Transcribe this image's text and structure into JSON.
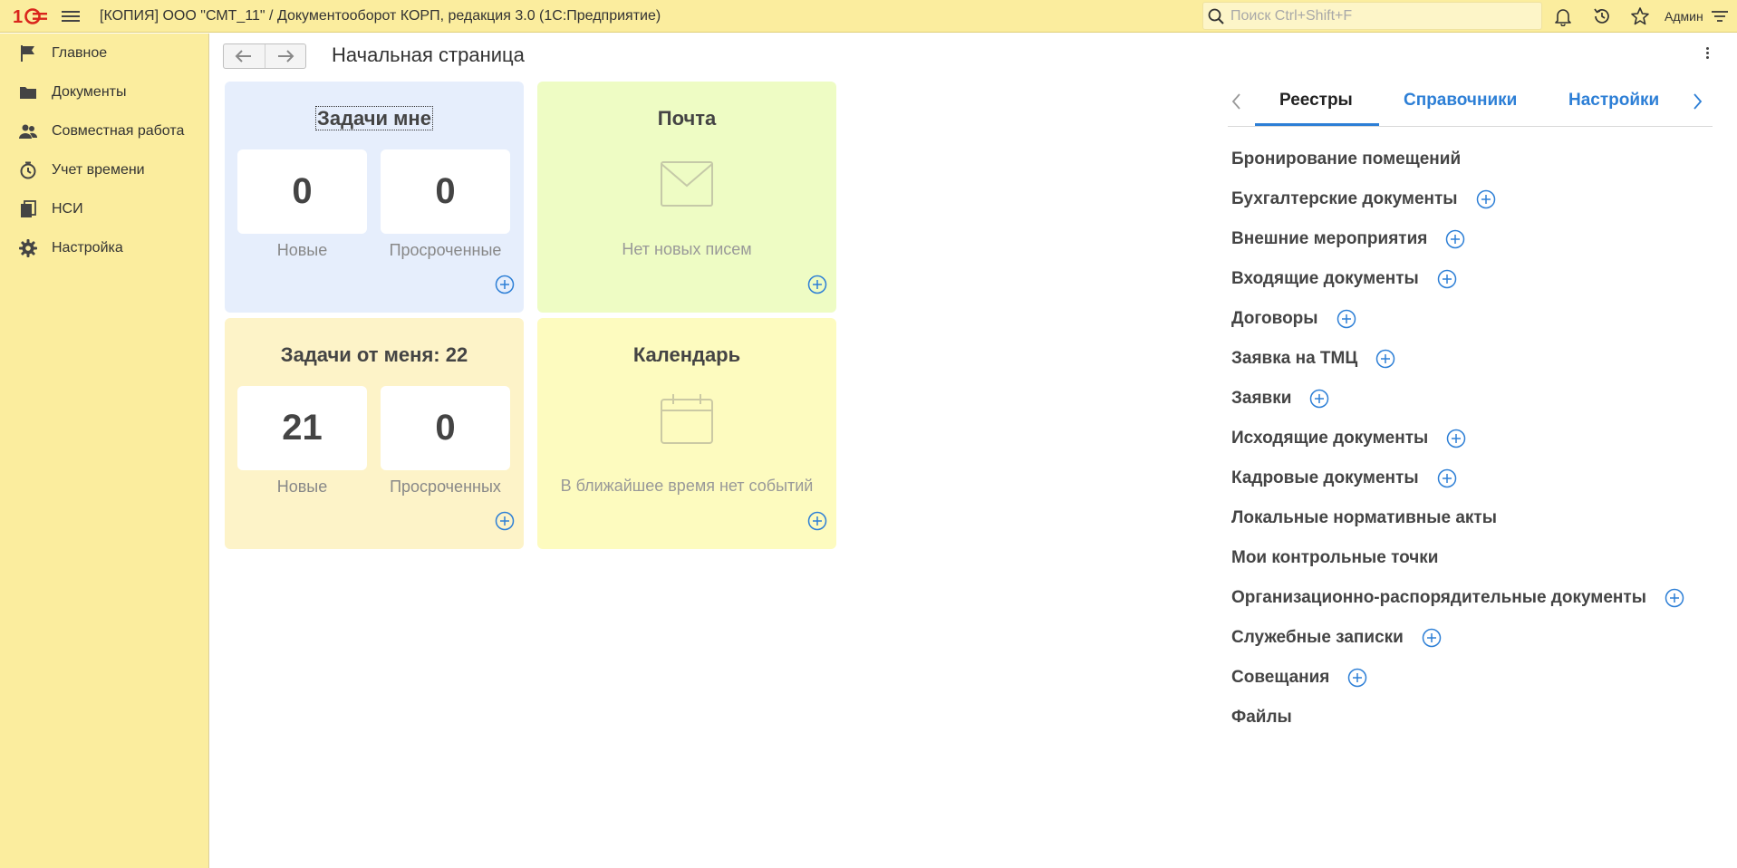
{
  "topbar": {
    "title": "[КОПИЯ] ООО \"СМТ_11\" / Документооборот КОРП, редакция 3.0  (1С:Предприятие)",
    "search_placeholder": "Поиск Ctrl+Shift+F",
    "user": "Админ",
    "icons": [
      "bell-icon",
      "history-icon",
      "star-icon",
      "settings-lines-icon"
    ]
  },
  "sidebar": {
    "items": [
      {
        "label": "Главное",
        "icon": "flag-icon"
      },
      {
        "label": "Документы",
        "icon": "folder-icon"
      },
      {
        "label": "Совместная работа",
        "icon": "people-icon"
      },
      {
        "label": "Учет времени",
        "icon": "stopwatch-icon"
      },
      {
        "label": "НСИ",
        "icon": "books-icon"
      },
      {
        "label": "Настройка",
        "icon": "gear-icon"
      }
    ]
  },
  "main": {
    "title": "Начальная страница"
  },
  "tiles": {
    "tasks_to_me": {
      "title": "Задачи мне",
      "new_count": "0",
      "new_label": "Новые",
      "overdue_count": "0",
      "overdue_label": "Просроченные",
      "color": "#e6eefc"
    },
    "mail": {
      "title": "Почта",
      "message": "Нет новых писем",
      "color": "#eefcc4"
    },
    "tasks_from_me": {
      "title": "Задачи от меня: 22",
      "new_count": "21",
      "new_label": "Новые",
      "overdue_count": "0",
      "overdue_label": "Просроченных",
      "color": "#fdf3c8"
    },
    "calendar": {
      "title": "Календарь",
      "message": "В ближайшее время нет событий",
      "color": "#fdfbbf"
    }
  },
  "right_panel": {
    "tabs": [
      {
        "label": "Реестры",
        "active": true
      },
      {
        "label": "Справочники",
        "active": false
      },
      {
        "label": "Настройки",
        "active": false
      }
    ],
    "registries": [
      {
        "label": "Бронирование помещений",
        "has_add": false
      },
      {
        "label": "Бухгалтерские документы",
        "has_add": true
      },
      {
        "label": "Внешние мероприятия",
        "has_add": true
      },
      {
        "label": "Входящие документы",
        "has_add": true
      },
      {
        "label": "Договоры",
        "has_add": true
      },
      {
        "label": "Заявка на ТМЦ",
        "has_add": true
      },
      {
        "label": "Заявки",
        "has_add": true
      },
      {
        "label": "Исходящие документы",
        "has_add": true
      },
      {
        "label": "Кадровые документы",
        "has_add": true
      },
      {
        "label": "Локальные нормативные акты",
        "has_add": false
      },
      {
        "label": "Мои контрольные точки",
        "has_add": false
      },
      {
        "label": "Организационно-распорядительные документы",
        "has_add": true
      },
      {
        "label": "Служебные записки",
        "has_add": true
      },
      {
        "label": "Совещания",
        "has_add": true
      },
      {
        "label": "Файлы",
        "has_add": false
      }
    ]
  },
  "colors": {
    "accent": "#2d7fd6",
    "topbar": "#fbed9e",
    "logo_red": "#d9251c"
  }
}
